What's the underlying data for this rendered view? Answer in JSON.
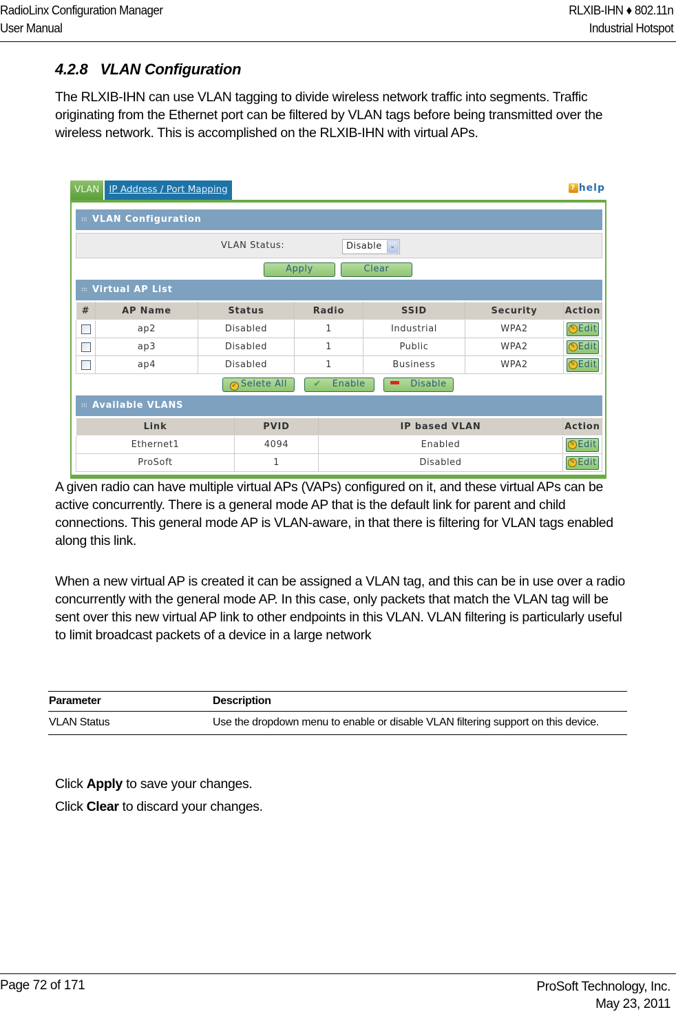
{
  "header": {
    "left_line1": "RadioLinx Configuration Manager",
    "left_line2": "User Manual",
    "right_line1": "RLXIB-IHN ♦ 802.11n",
    "right_line2": "Industrial Hotspot"
  },
  "section": {
    "number": "4.2.8",
    "title": "VLAN Configuration",
    "intro": "The RLXIB-IHN can use VLAN tagging to divide wireless network traffic into segments. Traffic originating from the Ethernet port can be filtered by VLAN tags before being transmitted over the wireless network. This is accomplished on the RLXIB-IHN with virtual APs."
  },
  "ui": {
    "tabs": [
      {
        "label": "VLAN",
        "active": true
      },
      {
        "label": "IP Address / Port Mapping",
        "active": false
      }
    ],
    "help_label": "help",
    "help_icon": "question-mark-icon",
    "vlan_config": {
      "title": "VLAN Configuration",
      "status_label": "VLAN Status:",
      "status_value": "Disable",
      "apply_label": "Apply",
      "clear_label": "Clear"
    },
    "vap_list": {
      "title": "Virtual AP List",
      "columns": [
        "#",
        "AP Name",
        "Status",
        "Radio",
        "SSID",
        "Security",
        "Action"
      ],
      "rows": [
        {
          "name": "ap2",
          "status": "Disabled",
          "radio": "1",
          "ssid": "Industrial",
          "security": "WPA2",
          "action": "Edit"
        },
        {
          "name": "ap3",
          "status": "Disabled",
          "radio": "1",
          "ssid": "Public",
          "security": "WPA2",
          "action": "Edit"
        },
        {
          "name": "ap4",
          "status": "Disabled",
          "radio": "1",
          "ssid": "Business",
          "security": "WPA2",
          "action": "Edit"
        }
      ],
      "select_all_label": "Selete All",
      "enable_label": "Enable",
      "disable_label": "Disable"
    },
    "available_vlans": {
      "title": "Available VLANS",
      "columns": [
        "Link",
        "PVID",
        "IP based VLAN",
        "Action"
      ],
      "rows": [
        {
          "link": "Ethernet1",
          "pvid": "4094",
          "ip_based": "Enabled",
          "action": "Edit"
        },
        {
          "link": "ProSoft",
          "pvid": "1",
          "ip_based": "Disabled",
          "action": "Edit"
        }
      ]
    },
    "colors": {
      "frame_green": "#6aaa45",
      "panel_blue": "#7da1bf",
      "tab_blue": "#1d73a6",
      "button_green": "#8ec56f"
    }
  },
  "body": {
    "para2": "A given radio can have multiple virtual APs (VAPs) configured on it, and these virtual APs can be active concurrently. There is a general mode AP that is the default link for parent and child connections. This general mode AP is VLAN-aware, in that there is filtering for VLAN tags enabled along this link.",
    "para3": "When a new virtual AP is created it can be assigned a VLAN tag, and this can be in use over a radio concurrently with the general mode AP. In this case, only packets that match the VLAN tag will be sent over this new virtual AP link to other endpoints in this VLAN. VLAN filtering is particularly useful to limit broadcast packets of a device in a large network"
  },
  "param_table": {
    "headers": [
      "Parameter",
      "Description"
    ],
    "rows": [
      {
        "parameter": "VLAN Status",
        "description": "Use the dropdown menu to enable or disable VLAN filtering support on this device."
      }
    ]
  },
  "instructions": [
    {
      "prefix": "Click ",
      "bold": "Apply",
      "suffix": " to save your changes."
    },
    {
      "prefix": "Click ",
      "bold": "Clear",
      "suffix": " to discard your changes."
    }
  ],
  "footer": {
    "page": "Page 72 of 171",
    "company": "ProSoft Technology, Inc.",
    "date": "May 23, 2011"
  }
}
